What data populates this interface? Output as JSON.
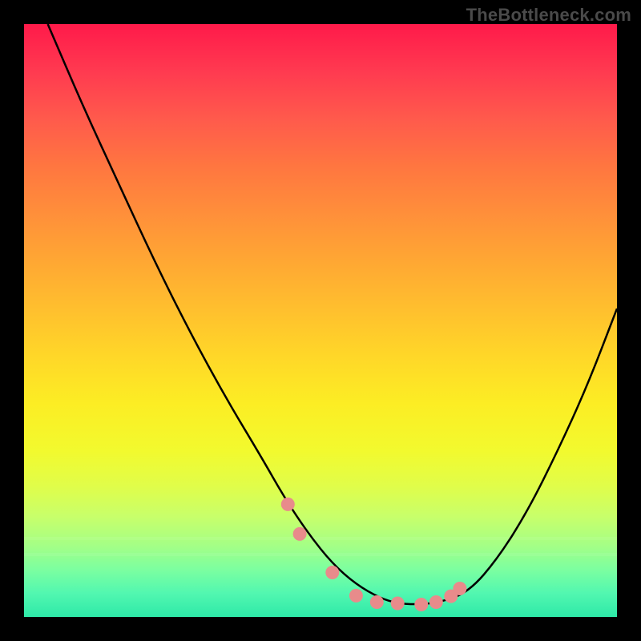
{
  "watermark": "TheBottleneck.com",
  "chart_data": {
    "type": "line",
    "title": "",
    "xlabel": "",
    "ylabel": "",
    "xlim": [
      0,
      100
    ],
    "ylim": [
      0,
      100
    ],
    "grid": false,
    "series": [
      {
        "name": "bottleneck-curve",
        "x": [
          4,
          10,
          16,
          22,
          28,
          34,
          40,
          44,
          48,
          52,
          56,
          60,
          63,
          66,
          70,
          75,
          80,
          85,
          90,
          95,
          100
        ],
        "values": [
          100,
          86,
          73,
          60,
          48,
          37,
          27,
          20,
          14,
          9,
          5.5,
          3.2,
          2.3,
          2.1,
          2.4,
          4.2,
          10,
          18,
          28,
          39,
          52
        ]
      }
    ],
    "markers": {
      "name": "highlight-points",
      "color": "#e88b8b",
      "x": [
        44.5,
        46.5,
        52.0,
        56.0,
        59.5,
        63.0,
        67.0,
        69.5,
        72.0,
        73.5
      ],
      "values": [
        19.0,
        14.0,
        7.5,
        3.6,
        2.5,
        2.3,
        2.1,
        2.5,
        3.5,
        4.8
      ]
    },
    "gradient_stops": [
      {
        "pos": 0,
        "color": "#ff1a4a"
      },
      {
        "pos": 50,
        "color": "#ffd728"
      },
      {
        "pos": 100,
        "color": "#2ee9a8"
      }
    ]
  }
}
